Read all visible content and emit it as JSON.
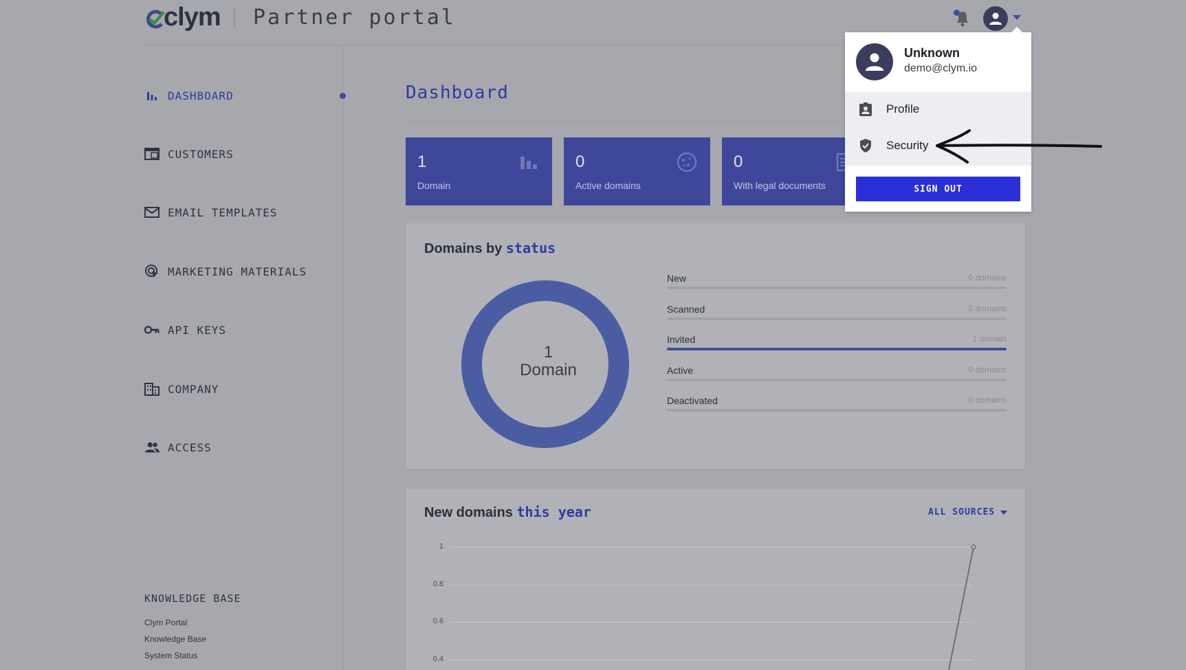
{
  "header": {
    "logo_text": "clym",
    "portal_title": "Partner portal"
  },
  "sidebar": {
    "items": [
      {
        "label": "DASHBOARD",
        "icon": "bar-chart-icon",
        "active": true
      },
      {
        "label": "CUSTOMERS",
        "icon": "browser-window-icon"
      },
      {
        "label": "EMAIL TEMPLATES",
        "icon": "envelope-icon"
      },
      {
        "label": "MARKETING MATERIALS",
        "icon": "target-cursor-icon"
      },
      {
        "label": "API KEYS",
        "icon": "key-icon"
      },
      {
        "label": "COMPANY",
        "icon": "building-icon"
      },
      {
        "label": "ACCESS",
        "icon": "people-icon"
      }
    ],
    "knowledge_base": {
      "title": "KNOWLEDGE BASE",
      "links": [
        "Clym Portal",
        "Knowledge Base",
        "System Status"
      ]
    }
  },
  "main": {
    "title": "Dashboard",
    "stats": [
      {
        "value": "1",
        "label": "Domain",
        "icon": "bar-chart-icon"
      },
      {
        "value": "0",
        "label": "Active domains",
        "icon": "cookie-icon"
      },
      {
        "value": "0",
        "label": "With legal documents",
        "icon": "document-icon"
      }
    ],
    "status_panel": {
      "title_prefix": "Domains by",
      "title_accent": "status",
      "donut_value": "1",
      "donut_unit": "Domain",
      "rows": [
        {
          "name": "New",
          "count": "0 domains",
          "fraction": 0
        },
        {
          "name": "Scanned",
          "count": "0 domains",
          "fraction": 0
        },
        {
          "name": "Invited",
          "count": "1 domain",
          "fraction": 1
        },
        {
          "name": "Active",
          "count": "0 domains",
          "fraction": 0
        },
        {
          "name": "Deactivated",
          "count": "0 domains",
          "fraction": 0
        }
      ]
    },
    "new_domains_panel": {
      "title_prefix": "New domains",
      "title_accent": "this year",
      "sources_label": "ALL SOURCES",
      "y_ticks": [
        "1",
        "0.8",
        "0.6",
        "0.4"
      ]
    }
  },
  "user_menu": {
    "name": "Unknown",
    "email": "demo@clym.io",
    "items": [
      {
        "label": "Profile",
        "icon": "badge-icon"
      },
      {
        "label": "Security",
        "icon": "shield-icon"
      }
    ],
    "sign_out_label": "SIGN OUT"
  },
  "colors": {
    "accent": "#2f3aa0",
    "sign_out": "#2a2fd8",
    "card": "#3e479a"
  }
}
